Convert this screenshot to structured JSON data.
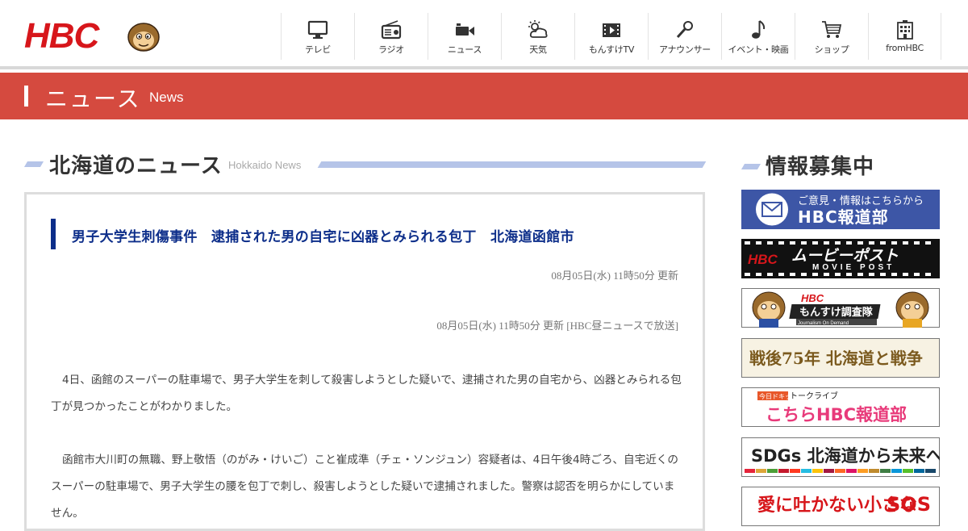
{
  "header": {
    "logo_text": "HBC",
    "nav": [
      {
        "label": "テレビ",
        "icon": "tv-icon"
      },
      {
        "label": "ラジオ",
        "icon": "radio-icon"
      },
      {
        "label": "ニュース",
        "icon": "video-camera-icon"
      },
      {
        "label": "天気",
        "icon": "weather-icon"
      },
      {
        "label": "もんすけTV",
        "icon": "film-icon"
      },
      {
        "label": "アナウンサー",
        "icon": "microphone-icon"
      },
      {
        "label": "イベント・映画",
        "icon": "music-note-icon"
      },
      {
        "label": "ショップ",
        "icon": "cart-icon"
      },
      {
        "label": "fromHBC",
        "icon": "building-icon"
      }
    ]
  },
  "banner": {
    "title": "ニュース",
    "subtitle": "News"
  },
  "section": {
    "title": "北海道のニュース",
    "subtitle": "Hokkaido News"
  },
  "article": {
    "title": "男子大学生刺傷事件　逮捕された男の自宅に凶器とみられる包丁　北海道函館市",
    "updated": "08月05日(水) 11時50分 更新",
    "updated_detail": "08月05日(水) 11時50分 更新 [HBC昼ニュースで放送]",
    "paragraphs": [
      "4日、函館のスーパーの駐車場で、男子大学生を刺して殺害しようとした疑いで、逮捕された男の自宅から、凶器とみられる包丁が見つかったことがわかりました。",
      "函館市大川町の無職、野上敬悟（のがみ・けいご）こと崔成準（チェ・ソンジュン）容疑者は、4日午後4時ごろ、自宅近くのスーパーの駐車場で、男子大学生の腰を包丁で刺し、殺害しようとした疑いで逮捕されました。警察は認否を明らかにしていません。"
    ]
  },
  "sidebar": {
    "title": "情報募集中",
    "banners": [
      {
        "line1": "ご意見・情報はこちらから",
        "line2": "HBC報道部",
        "color": "#3d56a6"
      },
      {
        "line1": "HBC",
        "line2": "ムービーポスト",
        "line3": "MOVIE POST",
        "color": "#111111"
      },
      {
        "line1": "HBC",
        "line2": "もんすけ調査隊",
        "line3": "Journalism On Demand"
      },
      {
        "line1": "戦後75年 北海道と戦争"
      },
      {
        "line1": "今日ドキッ!",
        "line2": "トークライブ",
        "line3": "こちらHBC報道部"
      },
      {
        "line1": "SDGs 北海道から未来へ"
      },
      {
        "line1": "SOS"
      }
    ]
  },
  "colors": {
    "brand_red": "#d7161b",
    "banner_red": "#d54a3f",
    "title_blue": "#0d2e8a",
    "accent_lightblue": "#b5c4e8"
  }
}
